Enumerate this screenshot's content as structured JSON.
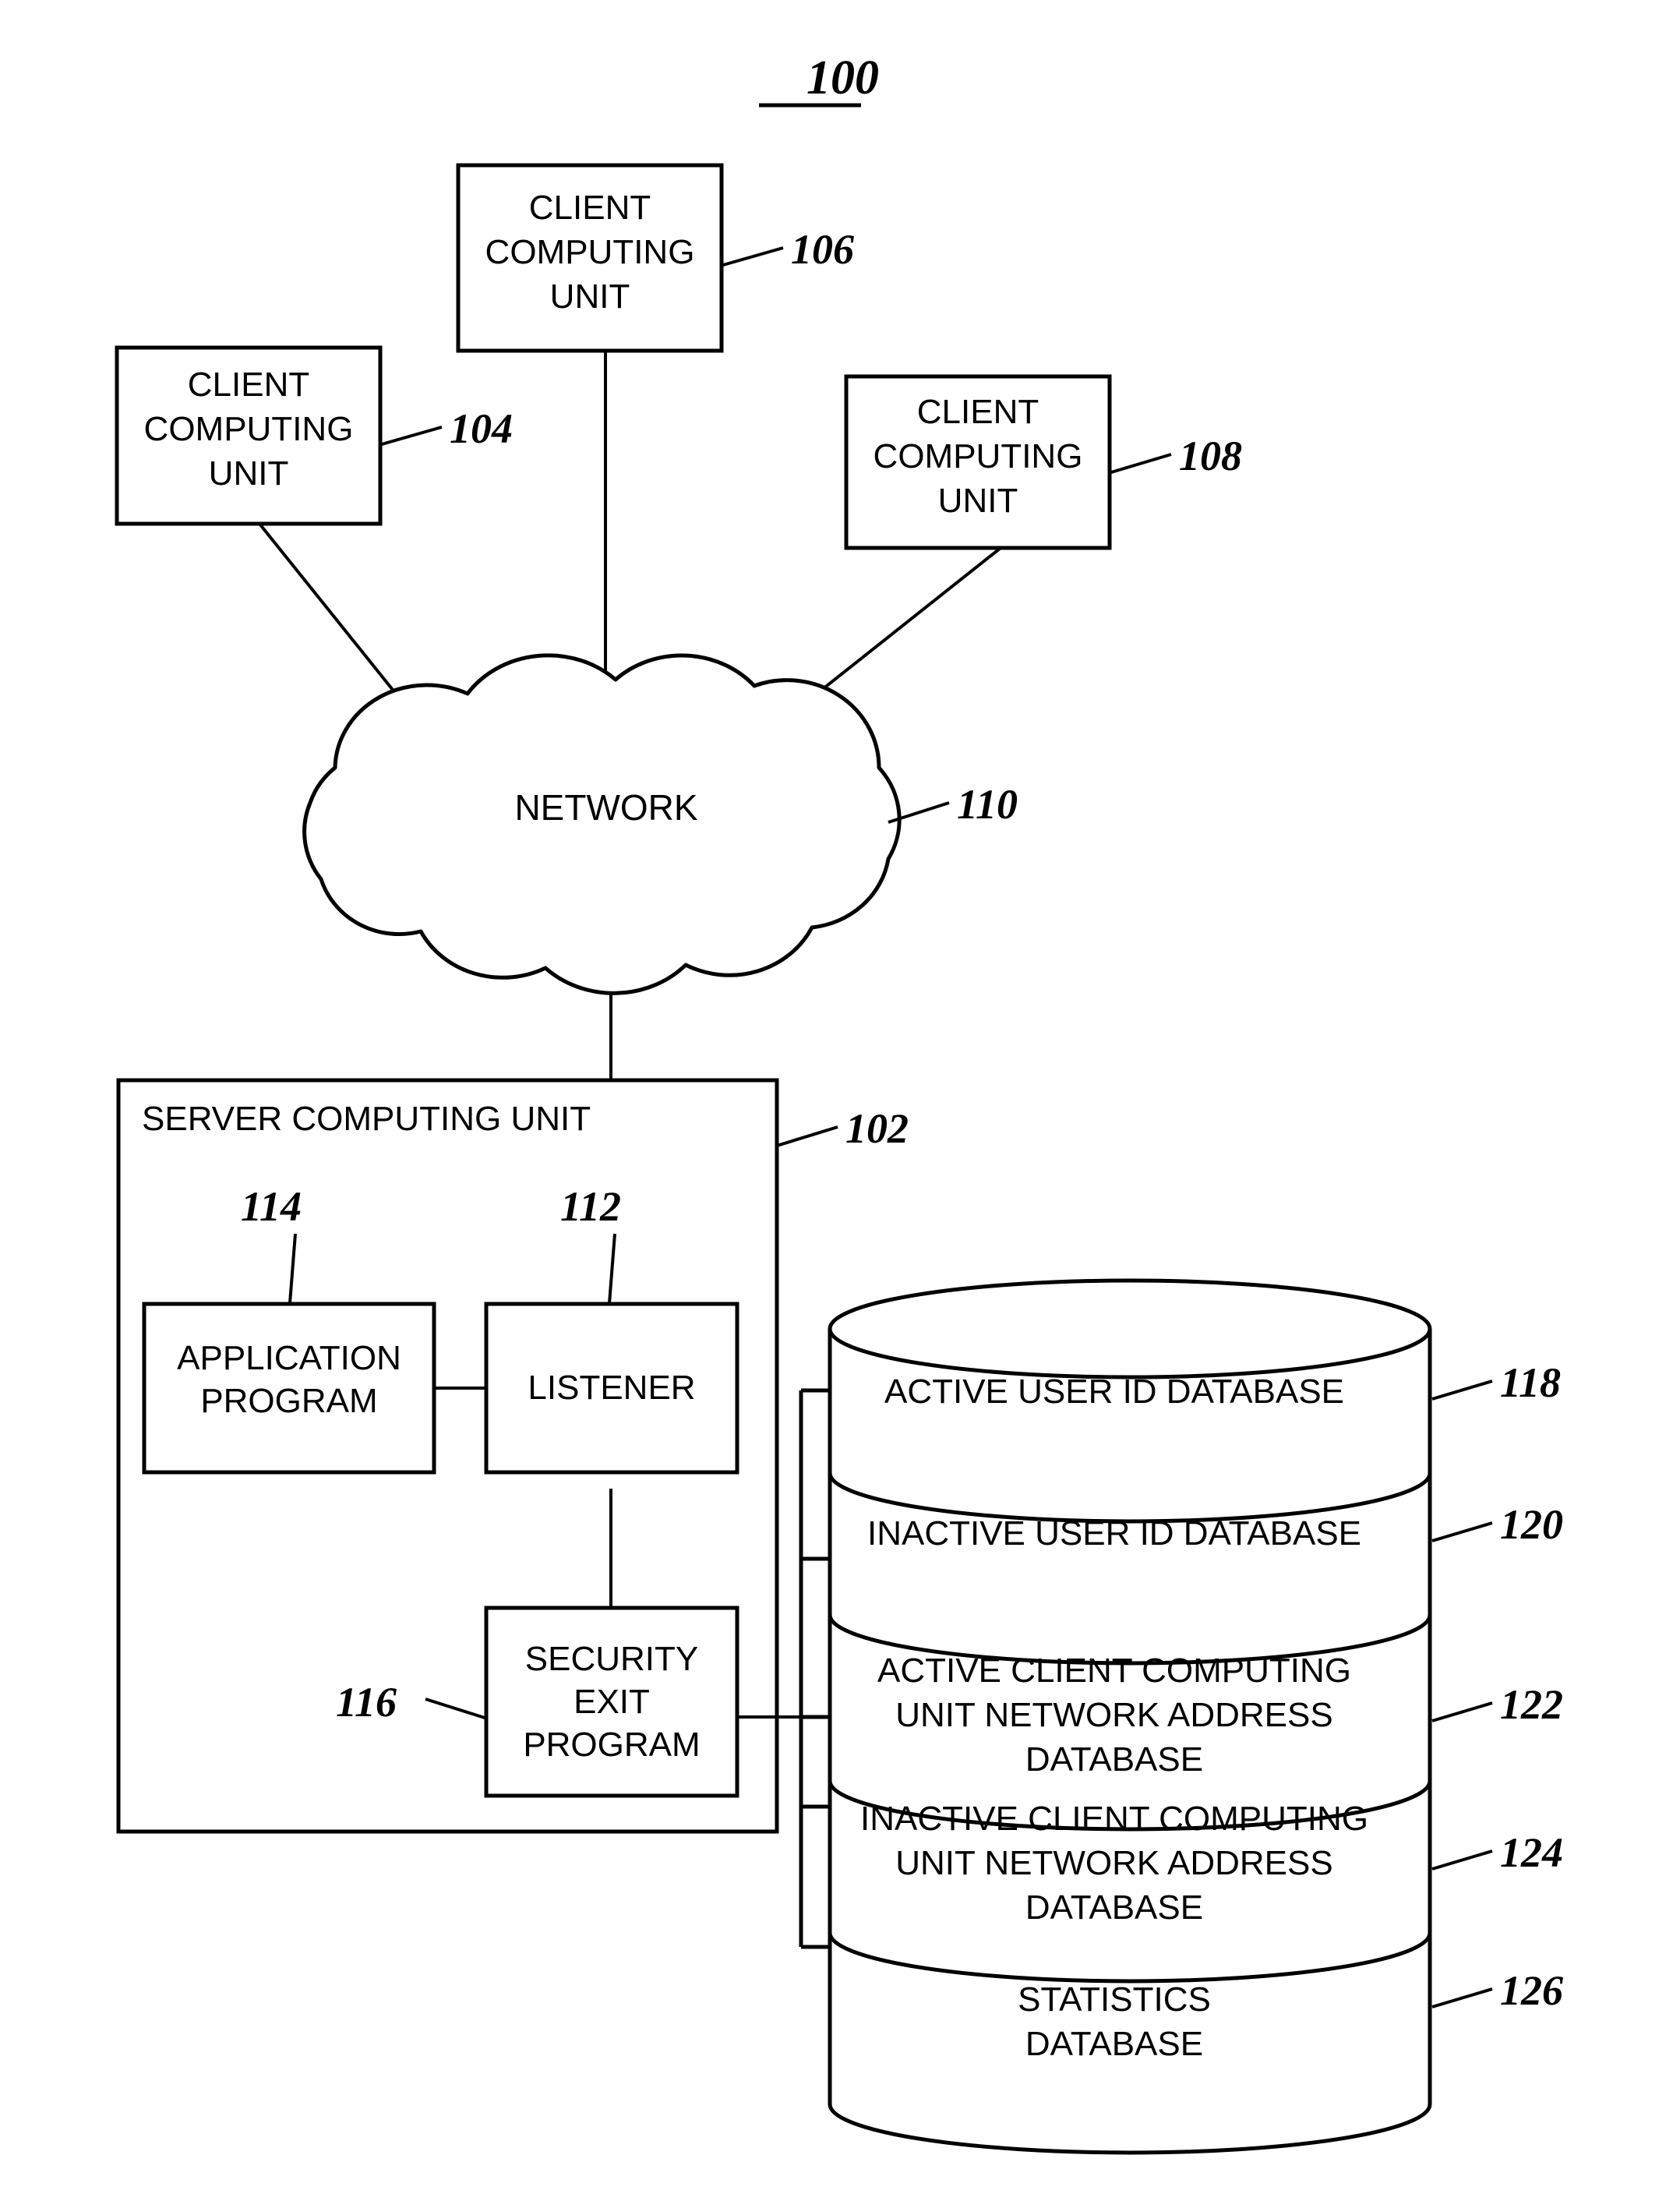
{
  "figure": {
    "title": "100",
    "background_color": "#ffffff",
    "line_color": "#000000"
  },
  "clients": [
    {
      "label_line1": "CLIENT",
      "label_line2": "COMPUTING",
      "label_line3": "UNIT",
      "ref": "104"
    },
    {
      "label_line1": "CLIENT",
      "label_line2": "COMPUTING",
      "label_line3": "UNIT",
      "ref": "106"
    },
    {
      "label_line1": "CLIENT",
      "label_line2": "COMPUTING",
      "label_line3": "UNIT",
      "ref": "108"
    }
  ],
  "network": {
    "label": "NETWORK",
    "ref": "110"
  },
  "server": {
    "label": "SERVER COMPUTING UNIT",
    "ref": "102",
    "components": [
      {
        "name": "application-program",
        "line1": "APPLICATION",
        "line2": "PROGRAM",
        "line3": "",
        "ref": "114"
      },
      {
        "name": "listener",
        "line1": "LISTENER",
        "line2": "",
        "line3": "",
        "ref": "112"
      },
      {
        "name": "security-exit-program",
        "line1": "SECURITY",
        "line2": "EXIT",
        "line3": "PROGRAM",
        "ref": "116"
      }
    ]
  },
  "databases": [
    {
      "name": "active-user-id-database",
      "line1": "ACTIVE USER ID DATABASE",
      "line2": "",
      "line3": "",
      "ref": "118"
    },
    {
      "name": "inactive-user-id-database",
      "line1": "INACTIVE USER ID DATABASE",
      "line2": "",
      "line3": "",
      "ref": "120"
    },
    {
      "name": "active-client-network-address-database",
      "line1": "ACTIVE CLIENT COMPUTING",
      "line2": "UNIT NETWORK ADDRESS",
      "line3": "DATABASE",
      "ref": "122"
    },
    {
      "name": "inactive-client-network-address-database",
      "line1": "INACTIVE CLIENT COMPUTING",
      "line2": "UNIT NETWORK ADDRESS",
      "line3": "DATABASE",
      "ref": "124"
    },
    {
      "name": "statistics-database",
      "line1": "STATISTICS",
      "line2": "DATABASE",
      "line3": "",
      "ref": "126"
    }
  ]
}
